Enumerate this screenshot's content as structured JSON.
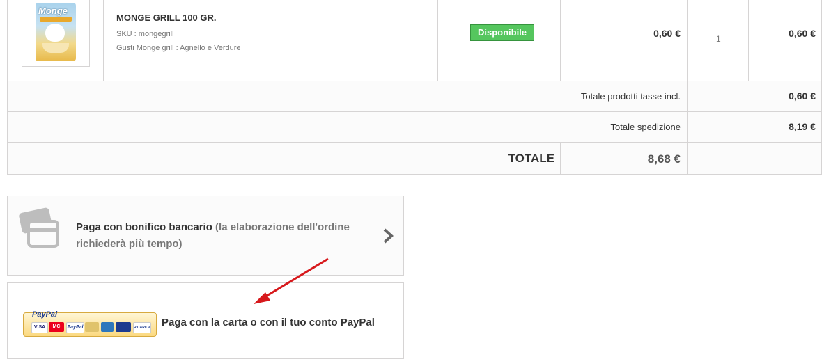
{
  "product": {
    "image_label": "Monge",
    "name": "MONGE GRILL 100 GR.",
    "sku": "SKU : mongegrill",
    "variant": "Gusti Monge grill : Agnello e Verdure",
    "availability": "Disponibile",
    "unit_price": "0,60 €",
    "quantity": "1",
    "line_total": "0,60 €"
  },
  "summary": {
    "products_label": "Totale prodotti tasse incl.",
    "products_value": "0,60 €",
    "shipping_label": "Totale spedizione",
    "shipping_value": "8,19 €",
    "total_label": "TOTALE",
    "total_value": "8,68 €"
  },
  "payment": {
    "bank_main": "Paga con bonifico bancario",
    "bank_sub": " (la elaborazione dell'ordine richiederà più tempo)",
    "paypal_text": "Paga con la carta o con il tuo conto PayPal",
    "paypal_logo": "PayPal",
    "cards": [
      "VISA",
      "MC",
      "PayPal",
      "",
      "",
      "",
      "RICARICA"
    ]
  },
  "colors": {
    "available_green": "#55c65e",
    "arrow_red": "#d7191c",
    "border": "#d6d4d4"
  },
  "icons": {
    "bank": "credit-card-icon",
    "next": "chevron-right-icon"
  }
}
